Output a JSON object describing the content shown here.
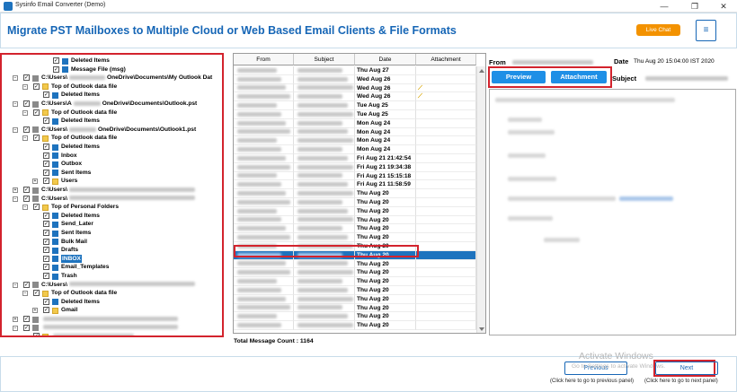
{
  "app": {
    "title": "Sysinfo Email Converter (Demo)"
  },
  "window_controls": {
    "minimize": "—",
    "restore": "❐",
    "close": "✕"
  },
  "header": {
    "title": "Migrate PST Mailboxes to Multiple Cloud or Web Based Email Clients & File Formats",
    "live_chat": "Live Chat",
    "menu": "≡"
  },
  "tree": {
    "items": [
      {
        "level": 4,
        "label": "Deleted Items",
        "icon": "file",
        "expander": ""
      },
      {
        "level": 4,
        "label": "Message File (msg)",
        "icon": "file",
        "expander": ""
      },
      {
        "level": 1,
        "label": "C:\\Users\\",
        "label_after": "OneDrive\\Documents\\My Outlook Dat",
        "icon": "pst",
        "expander": "⊟",
        "blur_w": 40
      },
      {
        "level": 2,
        "label": "Top of Outlook data file",
        "icon": "folder",
        "expander": "⊟"
      },
      {
        "level": 3,
        "label": "Deleted Items",
        "icon": "file",
        "expander": ""
      },
      {
        "level": 1,
        "label": "C:\\Users\\A",
        "label_after": "OneDrive\\Documents\\Outlook.pst",
        "icon": "pst",
        "expander": "⊟",
        "blur_w": 30
      },
      {
        "level": 2,
        "label": "Top of Outlook data file",
        "icon": "folder",
        "expander": "⊟"
      },
      {
        "level": 3,
        "label": "Deleted Items",
        "icon": "file",
        "expander": ""
      },
      {
        "level": 1,
        "label": "C:\\Users\\",
        "label_after": "OneDrive\\Documents\\Outlook1.pst",
        "icon": "pst",
        "expander": "⊟",
        "blur_w": 30
      },
      {
        "level": 2,
        "label": "Top of Outlook data file",
        "icon": "folder",
        "expander": "⊟"
      },
      {
        "level": 3,
        "label": "Deleted Items",
        "icon": "file",
        "expander": ""
      },
      {
        "level": 3,
        "label": "Inbox",
        "icon": "file",
        "expander": ""
      },
      {
        "level": 3,
        "label": "Outbox",
        "icon": "file",
        "expander": ""
      },
      {
        "level": 3,
        "label": "Sent Items",
        "icon": "file",
        "expander": ""
      },
      {
        "level": 3,
        "label": "Users",
        "icon": "folder",
        "expander": "⊞"
      },
      {
        "level": 1,
        "label": "C:\\Users\\",
        "label_after": "",
        "icon": "pst",
        "expander": "⊞",
        "blur_w": 140
      },
      {
        "level": 1,
        "label": "C:\\Users\\",
        "label_after": "",
        "icon": "pst",
        "expander": "⊟",
        "blur_w": 140
      },
      {
        "level": 2,
        "label": "Top of Personal Folders",
        "icon": "folder",
        "expander": "⊟"
      },
      {
        "level": 3,
        "label": "Deleted Items",
        "icon": "file",
        "expander": ""
      },
      {
        "level": 3,
        "label": "Send_Later",
        "icon": "file",
        "expander": ""
      },
      {
        "level": 3,
        "label": "Sent Items",
        "icon": "file",
        "expander": ""
      },
      {
        "level": 3,
        "label": "Bulk Mail",
        "icon": "file",
        "expander": ""
      },
      {
        "level": 3,
        "label": "Drafts",
        "icon": "file",
        "expander": ""
      },
      {
        "level": 3,
        "label": "INBOX",
        "icon": "file",
        "expander": "",
        "selected": true
      },
      {
        "level": 3,
        "label": "Email_Templates",
        "icon": "file",
        "expander": ""
      },
      {
        "level": 3,
        "label": "Trash",
        "icon": "file",
        "expander": ""
      },
      {
        "level": 1,
        "label": "C:\\Users\\",
        "label_after": "",
        "icon": "pst",
        "expander": "⊟",
        "blur_w": 140
      },
      {
        "level": 2,
        "label": "Top of Outlook data file",
        "icon": "folder",
        "expander": "⊟"
      },
      {
        "level": 3,
        "label": "Deleted Items",
        "icon": "file",
        "expander": ""
      },
      {
        "level": 3,
        "label": "Gmail",
        "icon": "folder",
        "expander": "⊞"
      },
      {
        "level": 1,
        "label": "",
        "label_after": "",
        "icon": "pst",
        "expander": "⊞",
        "blur_w": 150
      },
      {
        "level": 1,
        "label": "",
        "label_after": "",
        "icon": "pst",
        "expander": "⊟",
        "blur_w": 150
      },
      {
        "level": 2,
        "label": "",
        "label_after": "",
        "icon": "folder",
        "expander": "",
        "blur_w": 90
      }
    ]
  },
  "grid": {
    "columns": [
      "From",
      "Subject",
      "Date",
      "Attachment"
    ],
    "rows": [
      {
        "date": "Thu Aug 27",
        "attachment": false
      },
      {
        "date": "Wed Aug 26",
        "attachment": false
      },
      {
        "date": "Wed Aug 26",
        "attachment": true
      },
      {
        "date": "Wed Aug 26",
        "attachment": true
      },
      {
        "date": "Tue Aug 25",
        "attachment": false
      },
      {
        "date": "Tue Aug 25",
        "attachment": false
      },
      {
        "date": "Mon Aug 24",
        "attachment": false
      },
      {
        "date": "Mon Aug 24",
        "attachment": false
      },
      {
        "date": "Mon Aug 24",
        "attachment": false
      },
      {
        "date": "Mon Aug 24",
        "attachment": false
      },
      {
        "date": "Fri Aug 21 21:42:54",
        "attachment": false
      },
      {
        "date": "Fri Aug 21 19:34:38",
        "attachment": false
      },
      {
        "date": "Fri Aug 21 15:15:18",
        "attachment": false
      },
      {
        "date": "Fri Aug 21 11:58:59",
        "attachment": false
      },
      {
        "date": "Thu Aug 20",
        "attachment": false
      },
      {
        "date": "Thu Aug 20",
        "attachment": false
      },
      {
        "date": "Thu Aug 20",
        "attachment": false
      },
      {
        "date": "Thu Aug 20",
        "attachment": false
      },
      {
        "date": "Thu Aug 20",
        "attachment": false
      },
      {
        "date": "Thu Aug 20",
        "attachment": false
      },
      {
        "date": "Thu Aug 20",
        "attachment": false
      },
      {
        "date": "Thu Aug 20",
        "attachment": false,
        "selected": true
      },
      {
        "date": "Thu Aug 20",
        "attachment": false
      },
      {
        "date": "Thu Aug 20",
        "attachment": false
      },
      {
        "date": "Thu Aug 20",
        "attachment": false
      },
      {
        "date": "Thu Aug 20",
        "attachment": false
      },
      {
        "date": "Thu Aug 20",
        "attachment": false
      },
      {
        "date": "Thu Aug 20",
        "attachment": false
      },
      {
        "date": "Thu Aug 20",
        "attachment": false
      },
      {
        "date": "Thu Aug 20",
        "attachment": false
      }
    ],
    "total_label": "Total Message Count : 1164"
  },
  "preview": {
    "from_label": "From",
    "date_label": "Date",
    "date_value": "Thu Aug 20 15:04:00 IST 2020",
    "subject_label": "Subject",
    "tab_preview": "Preview",
    "tab_attachment": "Attachment"
  },
  "footer": {
    "previous": "Previous",
    "next": "Next",
    "previous_hint": "(Click here to go to previous panel)",
    "next_hint": "(Click here to go to next panel)",
    "watermark_title": "Activate Windows",
    "watermark_sub": "Go to Settings to activate Windows."
  },
  "colors": {
    "accent": "#1666b6",
    "highlight": "#d3232d",
    "live_chat": "#f39200",
    "selection": "#1e73be"
  }
}
